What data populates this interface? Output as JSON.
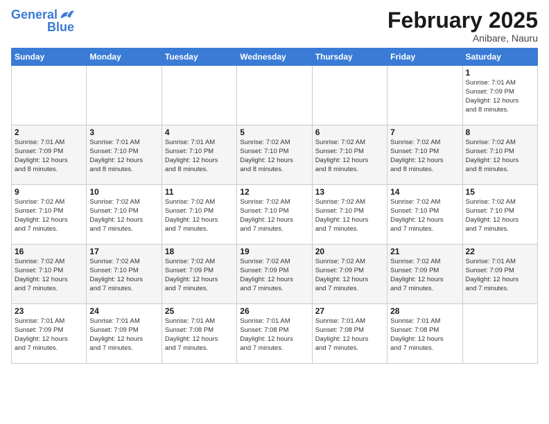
{
  "logo": {
    "line1": "General",
    "line2": "Blue"
  },
  "title": "February 2025",
  "subtitle": "Anibare, Nauru",
  "days_header": [
    "Sunday",
    "Monday",
    "Tuesday",
    "Wednesday",
    "Thursday",
    "Friday",
    "Saturday"
  ],
  "weeks": [
    [
      {
        "day": "",
        "info": ""
      },
      {
        "day": "",
        "info": ""
      },
      {
        "day": "",
        "info": ""
      },
      {
        "day": "",
        "info": ""
      },
      {
        "day": "",
        "info": ""
      },
      {
        "day": "",
        "info": ""
      },
      {
        "day": "1",
        "info": "Sunrise: 7:01 AM\nSunset: 7:09 PM\nDaylight: 12 hours\nand 8 minutes."
      }
    ],
    [
      {
        "day": "2",
        "info": "Sunrise: 7:01 AM\nSunset: 7:09 PM\nDaylight: 12 hours\nand 8 minutes."
      },
      {
        "day": "3",
        "info": "Sunrise: 7:01 AM\nSunset: 7:10 PM\nDaylight: 12 hours\nand 8 minutes."
      },
      {
        "day": "4",
        "info": "Sunrise: 7:01 AM\nSunset: 7:10 PM\nDaylight: 12 hours\nand 8 minutes."
      },
      {
        "day": "5",
        "info": "Sunrise: 7:02 AM\nSunset: 7:10 PM\nDaylight: 12 hours\nand 8 minutes."
      },
      {
        "day": "6",
        "info": "Sunrise: 7:02 AM\nSunset: 7:10 PM\nDaylight: 12 hours\nand 8 minutes."
      },
      {
        "day": "7",
        "info": "Sunrise: 7:02 AM\nSunset: 7:10 PM\nDaylight: 12 hours\nand 8 minutes."
      },
      {
        "day": "8",
        "info": "Sunrise: 7:02 AM\nSunset: 7:10 PM\nDaylight: 12 hours\nand 8 minutes."
      }
    ],
    [
      {
        "day": "9",
        "info": "Sunrise: 7:02 AM\nSunset: 7:10 PM\nDaylight: 12 hours\nand 7 minutes."
      },
      {
        "day": "10",
        "info": "Sunrise: 7:02 AM\nSunset: 7:10 PM\nDaylight: 12 hours\nand 7 minutes."
      },
      {
        "day": "11",
        "info": "Sunrise: 7:02 AM\nSunset: 7:10 PM\nDaylight: 12 hours\nand 7 minutes."
      },
      {
        "day": "12",
        "info": "Sunrise: 7:02 AM\nSunset: 7:10 PM\nDaylight: 12 hours\nand 7 minutes."
      },
      {
        "day": "13",
        "info": "Sunrise: 7:02 AM\nSunset: 7:10 PM\nDaylight: 12 hours\nand 7 minutes."
      },
      {
        "day": "14",
        "info": "Sunrise: 7:02 AM\nSunset: 7:10 PM\nDaylight: 12 hours\nand 7 minutes."
      },
      {
        "day": "15",
        "info": "Sunrise: 7:02 AM\nSunset: 7:10 PM\nDaylight: 12 hours\nand 7 minutes."
      }
    ],
    [
      {
        "day": "16",
        "info": "Sunrise: 7:02 AM\nSunset: 7:10 PM\nDaylight: 12 hours\nand 7 minutes."
      },
      {
        "day": "17",
        "info": "Sunrise: 7:02 AM\nSunset: 7:10 PM\nDaylight: 12 hours\nand 7 minutes."
      },
      {
        "day": "18",
        "info": "Sunrise: 7:02 AM\nSunset: 7:09 PM\nDaylight: 12 hours\nand 7 minutes."
      },
      {
        "day": "19",
        "info": "Sunrise: 7:02 AM\nSunset: 7:09 PM\nDaylight: 12 hours\nand 7 minutes."
      },
      {
        "day": "20",
        "info": "Sunrise: 7:02 AM\nSunset: 7:09 PM\nDaylight: 12 hours\nand 7 minutes."
      },
      {
        "day": "21",
        "info": "Sunrise: 7:02 AM\nSunset: 7:09 PM\nDaylight: 12 hours\nand 7 minutes."
      },
      {
        "day": "22",
        "info": "Sunrise: 7:01 AM\nSunset: 7:09 PM\nDaylight: 12 hours\nand 7 minutes."
      }
    ],
    [
      {
        "day": "23",
        "info": "Sunrise: 7:01 AM\nSunset: 7:09 PM\nDaylight: 12 hours\nand 7 minutes."
      },
      {
        "day": "24",
        "info": "Sunrise: 7:01 AM\nSunset: 7:09 PM\nDaylight: 12 hours\nand 7 minutes."
      },
      {
        "day": "25",
        "info": "Sunrise: 7:01 AM\nSunset: 7:08 PM\nDaylight: 12 hours\nand 7 minutes."
      },
      {
        "day": "26",
        "info": "Sunrise: 7:01 AM\nSunset: 7:08 PM\nDaylight: 12 hours\nand 7 minutes."
      },
      {
        "day": "27",
        "info": "Sunrise: 7:01 AM\nSunset: 7:08 PM\nDaylight: 12 hours\nand 7 minutes."
      },
      {
        "day": "28",
        "info": "Sunrise: 7:01 AM\nSunset: 7:08 PM\nDaylight: 12 hours\nand 7 minutes."
      },
      {
        "day": "",
        "info": ""
      }
    ]
  ]
}
